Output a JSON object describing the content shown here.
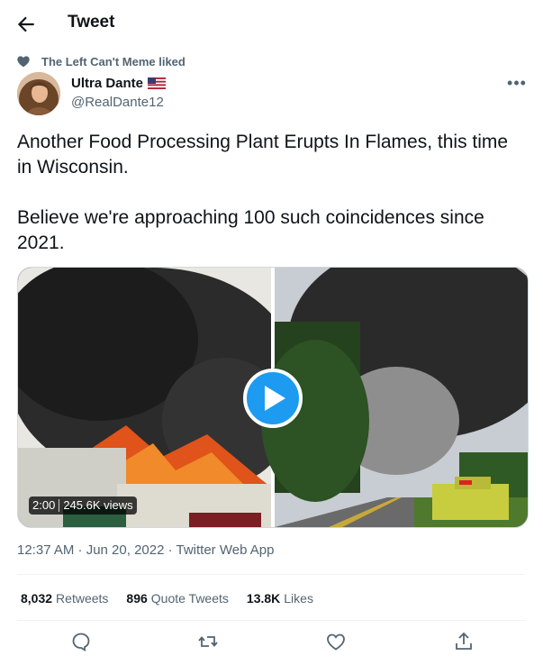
{
  "header": {
    "title": "Tweet"
  },
  "social_context": {
    "text": "The Left Can't Meme liked"
  },
  "author": {
    "display_name": "Ultra Dante",
    "handle": "@RealDante12"
  },
  "tweet": {
    "paragraphs": [
      "Another Food Processing Plant Erupts In Flames, this time in Wisconsin.",
      "Believe we're approaching 100 such coincidences since 2021."
    ]
  },
  "media": {
    "duration": "2:00",
    "views": "245.6K views"
  },
  "meta": {
    "timestamp": "12:37 AM · Jun 20, 2022 · Twitter Web App"
  },
  "stats": {
    "retweets_count": "8,032",
    "retweets_label": "Retweets",
    "quotes_count": "896",
    "quotes_label": "Quote Tweets",
    "likes_count": "13.8K",
    "likes_label": "Likes"
  },
  "icons": [
    "back-arrow-icon",
    "heart-icon",
    "flag-icon",
    "more-icon",
    "play-icon",
    "reply-icon",
    "retweet-icon",
    "like-icon",
    "share-icon"
  ],
  "colors": {
    "accent": "#1d9bf0",
    "secondary_text": "#536471",
    "divider": "#eff3f4"
  }
}
